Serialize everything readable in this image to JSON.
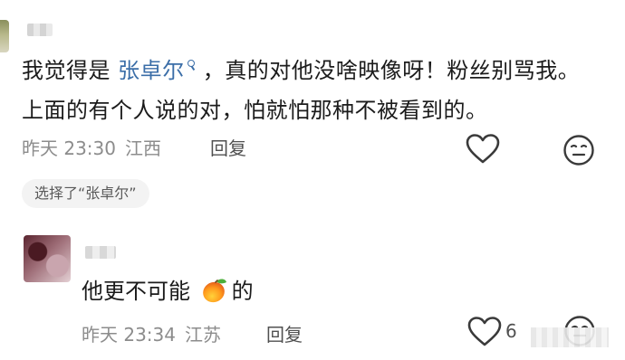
{
  "comment_main": {
    "text_before_mention": "我觉得是 ",
    "mention": "张卓尔",
    "text_after_mention": " ，真的对他没啥映像呀！粉丝别骂我。上面的有个人说的对，怕就怕那种不被看到的。",
    "time": "昨天 23:30",
    "location": "江西",
    "reply_label": "回复",
    "choice_tag": "选择了“张卓尔”"
  },
  "comment_reply": {
    "text_before_emoji": "他更不可能 ",
    "emoji": "mango-emoji",
    "text_after_emoji": "的",
    "time": "昨天 23:34",
    "location": "江苏",
    "reply_label": "回复",
    "like_count": "6"
  },
  "icons": {
    "like": "heart-outline-icon",
    "reaction": "face-icon"
  },
  "colors": {
    "mention": "#3b6ea8",
    "meta_text": "#8c8c8c",
    "main_text": "#1b1b1b"
  }
}
